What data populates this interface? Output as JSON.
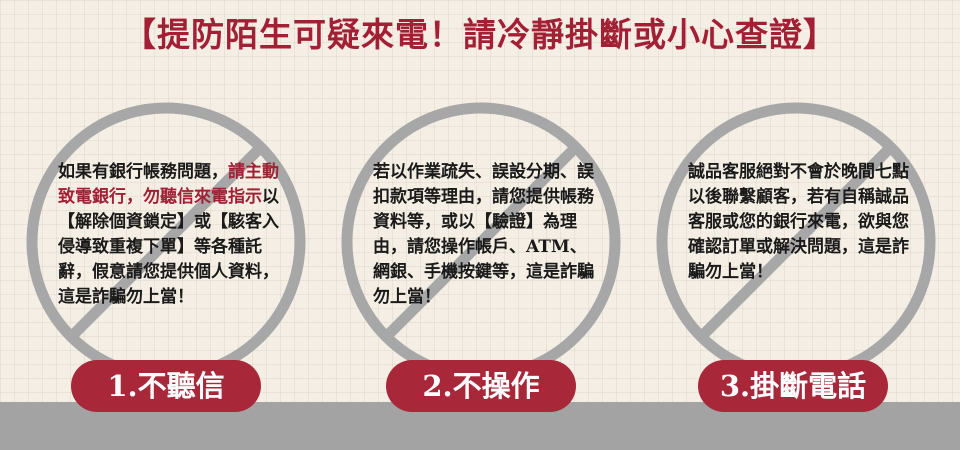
{
  "title": "【提防陌生可疑來電！請冷靜掛斷或小心查證】",
  "colors": {
    "accent": "#a31f34",
    "pill": "#a8283a",
    "ring": "#a7a7a7",
    "paper": "#f4eee4"
  },
  "cards": [
    {
      "segments": [
        {
          "text": "如果有銀行帳務問題，",
          "red": false
        },
        {
          "text": "請主動致電銀行，勿聽信來電指示",
          "red": true
        },
        {
          "text": "以【解除個資鎖定】或【駭客入侵導致重複下單】等各種託辭，假意請您提供個人資料，這是詐騙勿上當！",
          "red": false
        }
      ],
      "label": "1.不聽信"
    },
    {
      "segments": [
        {
          "text": "若以作業疏失、誤設分期、誤扣款項等理由，請您提供帳務資料等，或以【驗證】為理由，請您操作帳戶、ATM、網銀、手機按鍵等，這是詐騙勿上當！",
          "red": false
        }
      ],
      "label": "2.不操作"
    },
    {
      "segments": [
        {
          "text": "誠品客服絕對不會於晚間七點以後聯繫顧客，若有自稱誠品客服或您的銀行來電，欲與您確認訂單或解決問題，這是詐騙勿上當！",
          "red": false
        }
      ],
      "label": "3.掛斷電話"
    }
  ]
}
